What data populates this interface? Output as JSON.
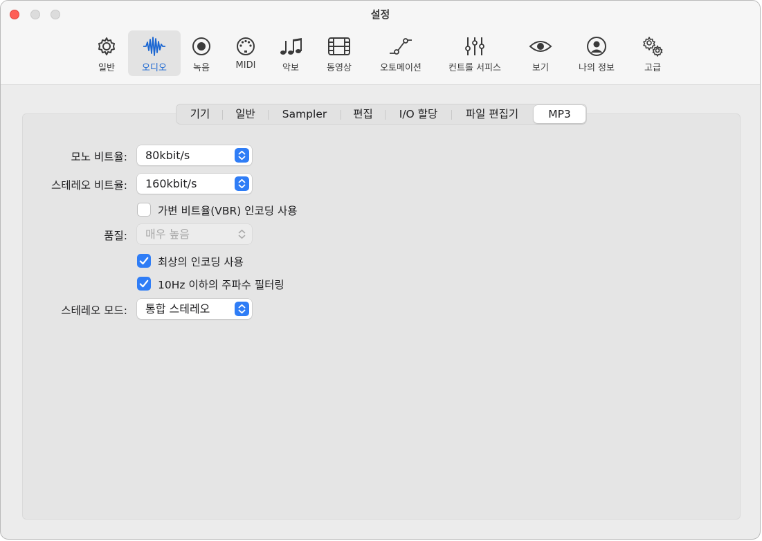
{
  "window": {
    "title": "설정"
  },
  "toolbar": {
    "items": [
      {
        "label": "일반",
        "icon": "gear-icon"
      },
      {
        "label": "오디오",
        "icon": "audio-waveform-icon",
        "selected": true
      },
      {
        "label": "녹음",
        "icon": "record-icon"
      },
      {
        "label": "MIDI",
        "icon": "midi-connector-icon"
      },
      {
        "label": "악보",
        "icon": "music-notes-icon"
      },
      {
        "label": "동영상",
        "icon": "film-icon"
      },
      {
        "label": "오토메이션",
        "icon": "automation-curve-icon"
      },
      {
        "label": "컨트롤 서피스",
        "icon": "faders-icon"
      },
      {
        "label": "보기",
        "icon": "eye-icon"
      },
      {
        "label": "나의 정보",
        "icon": "person-icon"
      },
      {
        "label": "고급",
        "icon": "advanced-gears-icon"
      }
    ]
  },
  "tabs": [
    {
      "label": "기기"
    },
    {
      "label": "일반"
    },
    {
      "label": "Sampler"
    },
    {
      "label": "편집"
    },
    {
      "label": "I/O 할당"
    },
    {
      "label": "파일 편집기"
    },
    {
      "label": "MP3",
      "active": true
    }
  ],
  "form": {
    "mono_bitrate": {
      "label": "모노 비트율:",
      "value": "80kbit/s"
    },
    "stereo_bitrate": {
      "label": "스테레오 비트율:",
      "value": "160kbit/s"
    },
    "vbr": {
      "label": "가변 비트율(VBR) 인코딩 사용",
      "checked": false
    },
    "quality": {
      "label": "품질:",
      "value": "매우 높음",
      "enabled": false
    },
    "best_encoding": {
      "label": "최상의 인코딩 사용",
      "checked": true
    },
    "filter_10hz": {
      "label": "10Hz 이하의 주파수 필터링",
      "checked": true
    },
    "stereo_mode": {
      "label": "스테레오 모드:",
      "value": "통합 스테레오"
    }
  },
  "colors": {
    "accent": "#2f7df6",
    "selected_label": "#1a66d2",
    "close_button": "#fe5f57"
  }
}
